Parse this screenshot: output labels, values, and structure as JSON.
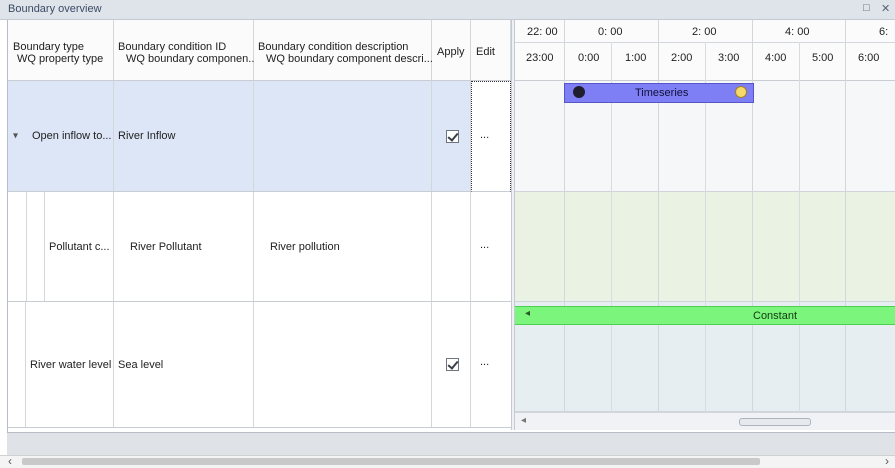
{
  "window": {
    "title": "Boundary overview",
    "restore_glyph": "□",
    "close_glyph": "✕"
  },
  "grid": {
    "headers": {
      "boundary_type": [
        "Boundary type",
        "WQ property type"
      ],
      "condition_id": [
        "Boundary condition ID",
        "WQ boundary componen..."
      ],
      "condition_desc": [
        "Boundary condition description",
        "WQ boundary component descri..."
      ],
      "apply": "Apply",
      "edit": "Edit"
    },
    "rows": [
      {
        "type": "Open inflow to...",
        "id": "River Inflow",
        "desc": "",
        "apply": true,
        "edit": "...",
        "expander": "▾",
        "selected": true
      },
      {
        "type": "Pollutant c...",
        "id": "River Pollutant",
        "desc": "River pollution",
        "apply": false,
        "edit": "..."
      },
      {
        "type": "River water level",
        "id": "Sea level",
        "desc": "",
        "apply": true,
        "edit": "..."
      }
    ]
  },
  "timeline": {
    "top_ticks": [
      "22: 00",
      "0: 00",
      "2: 00",
      "4: 00",
      "6:"
    ],
    "bottom_ticks": [
      "23:00",
      "0:00",
      "1:00",
      "2:00",
      "3:00",
      "4:00",
      "5:00",
      "6:00"
    ],
    "bars": [
      {
        "label": "Timeseries",
        "color": "#7f7ff5",
        "row": 0
      },
      {
        "label": "Constant",
        "color": "#7cf57c",
        "row": 2
      }
    ],
    "band_colors": [
      "#f6f7f9",
      "#eaf2e3",
      "#e7eef2"
    ]
  },
  "scroll": {
    "left_arrow": "‹",
    "right_arrow": "›"
  }
}
